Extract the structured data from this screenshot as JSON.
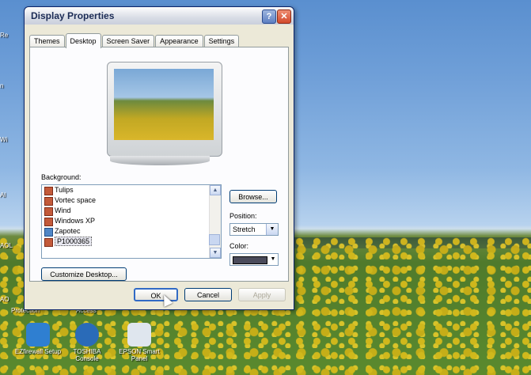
{
  "desktop": {
    "sidebar_labels": [
      "Re",
      "n",
      "Wi",
      "Al",
      "AOL",
      "AO"
    ],
    "icons": [
      {
        "name": "ez-firewall-icon",
        "label": "EZfirewall Setup",
        "color": "#2f7fd1"
      },
      {
        "name": "toshiba-console-icon",
        "label": "TOSHIBA Console",
        "color": "#2a6bb8"
      },
      {
        "name": "epson-smart-panel-icon",
        "label": "EPSON Smart Panel",
        "color": "#dfe6ee"
      }
    ],
    "partial_labels": [
      "Protection",
      "Access"
    ]
  },
  "window": {
    "title": "Display Properties",
    "help_button": "?",
    "close_button": "✕",
    "tabs": [
      "Themes",
      "Desktop",
      "Screen Saver",
      "Appearance",
      "Settings"
    ],
    "active_tab": "Desktop",
    "background_label": "Background:",
    "background_items": [
      {
        "label": "Tulips",
        "icon": "image-icon"
      },
      {
        "label": "Vortec space",
        "icon": "image-icon"
      },
      {
        "label": "Wind",
        "icon": "image-icon"
      },
      {
        "label": "Windows XP",
        "icon": "image-icon"
      },
      {
        "label": "Zapotec",
        "icon": "folder-icon"
      },
      {
        "label": "P1000365",
        "icon": "image-icon"
      }
    ],
    "selected_background": "P1000365",
    "browse_label": "Browse...",
    "position_label": "Position:",
    "position_value": "Stretch",
    "color_label": "Color:",
    "color_value": "#4a4a5a",
    "customize_label": "Customize Desktop...",
    "ok_label": "OK",
    "cancel_label": "Cancel",
    "apply_label": "Apply"
  }
}
